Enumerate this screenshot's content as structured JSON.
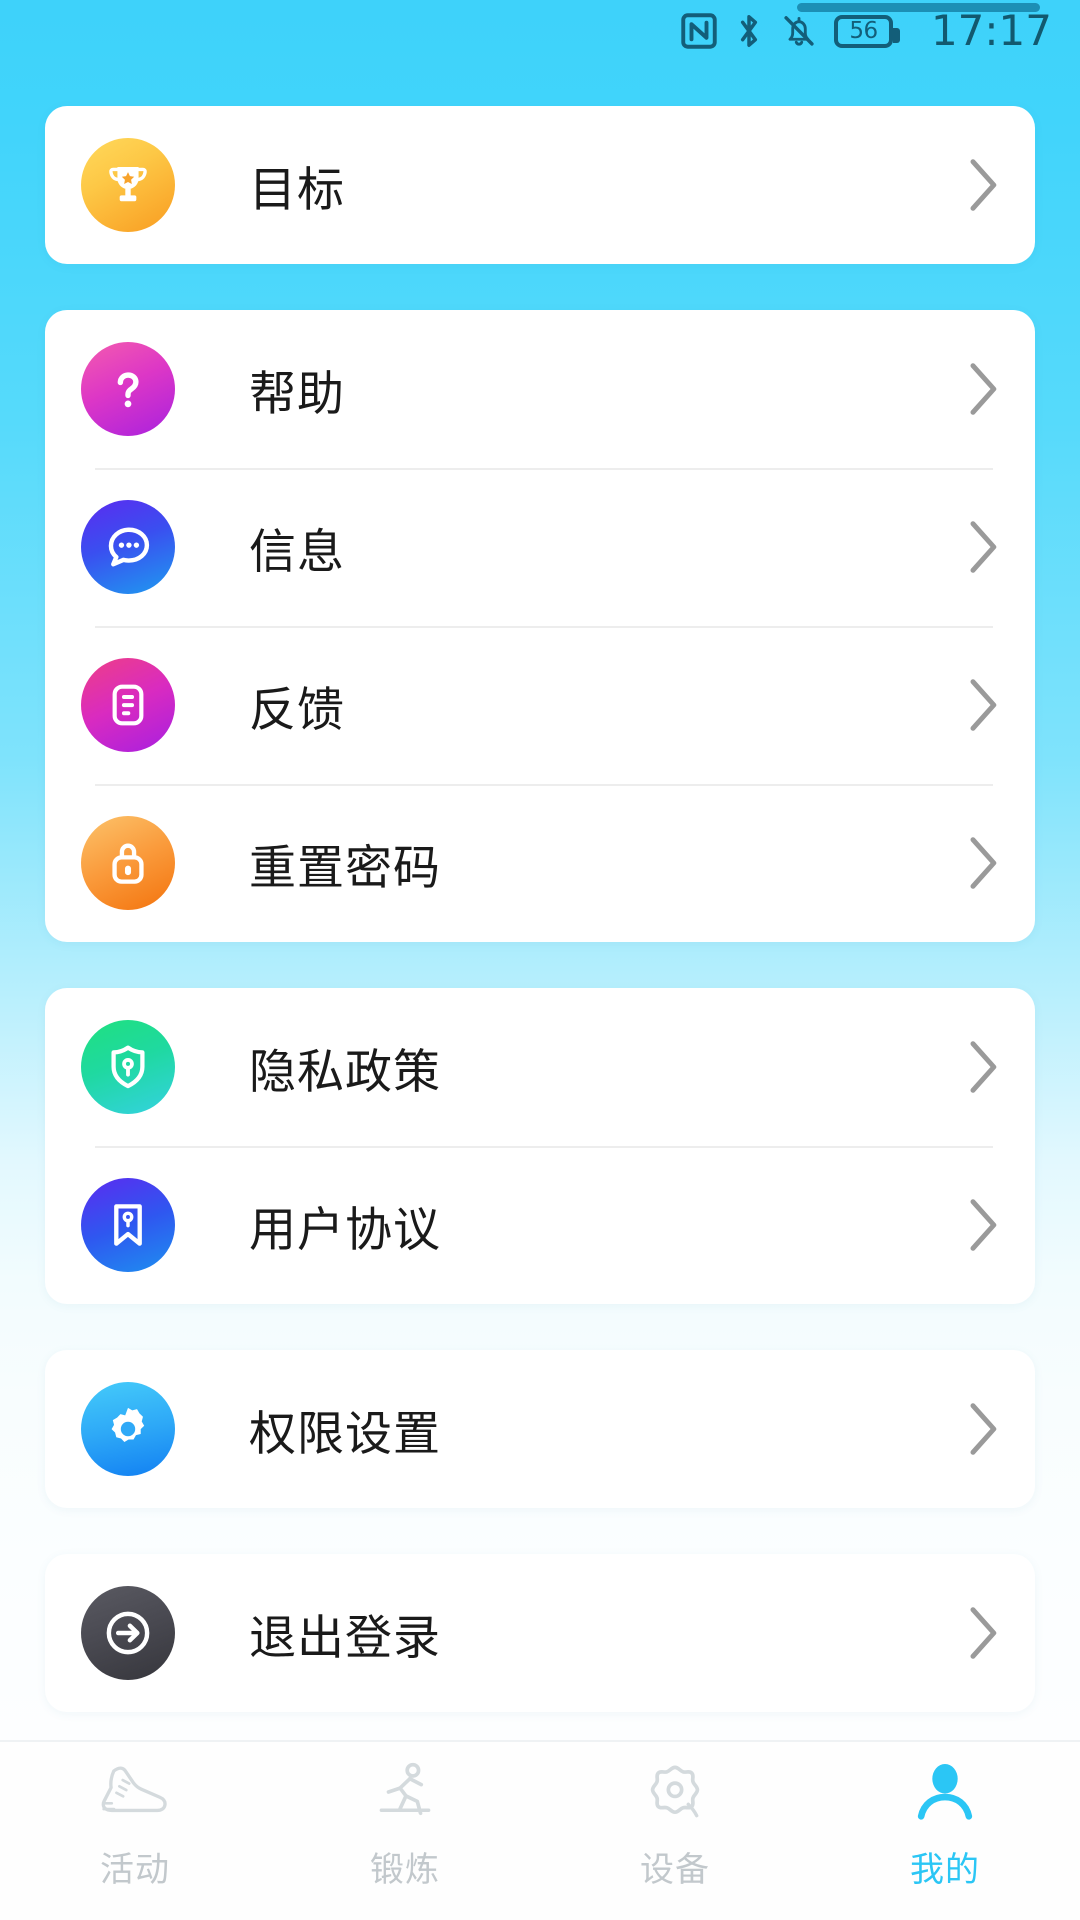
{
  "status_bar": {
    "icons": [
      "nfc-icon",
      "bluetooth-icon",
      "mute-bell-icon"
    ],
    "battery_level": "56",
    "time": "17:17"
  },
  "theme": {
    "background_top": "#3ED2FA",
    "background_bottom": "#FDFEFF",
    "card_background": "#FFFFFF",
    "label_color": "#1A1A1A",
    "chevron_color": "#9A9A9A",
    "accent": "#2BC6F5",
    "nav_inactive": "#C2C8CC"
  },
  "sections": [
    {
      "name": "goals-section",
      "items": [
        {
          "label": "目标",
          "icon": "trophy-icon",
          "icon_style": "g-trophy",
          "name": "goals"
        }
      ]
    },
    {
      "name": "support-section",
      "items": [
        {
          "label": "帮助",
          "icon": "question-mark-icon",
          "icon_style": "g-help",
          "name": "help"
        },
        {
          "label": "信息",
          "icon": "chat-bubble-icon",
          "icon_style": "g-msg",
          "name": "messages"
        },
        {
          "label": "反馈",
          "icon": "document-icon",
          "icon_style": "g-feed",
          "name": "feedback"
        },
        {
          "label": "重置密码",
          "icon": "lock-icon",
          "icon_style": "g-lock",
          "name": "reset-password"
        }
      ]
    },
    {
      "name": "legal-section",
      "items": [
        {
          "label": "隐私政策",
          "icon": "shield-keyhole-icon",
          "icon_style": "g-shield",
          "name": "privacy-policy"
        },
        {
          "label": "用户协议",
          "icon": "bookmark-icon",
          "icon_style": "g-agree",
          "name": "user-agreement"
        }
      ]
    },
    {
      "name": "settings-section",
      "items": [
        {
          "label": "权限设置",
          "icon": "gear-icon",
          "icon_style": "g-perm",
          "name": "permission-settings"
        }
      ]
    },
    {
      "name": "account-section",
      "items": [
        {
          "label": "退出登录",
          "icon": "logout-arrow-icon",
          "icon_style": "g-logout",
          "name": "logout"
        }
      ]
    }
  ],
  "bottom_nav": {
    "items": [
      {
        "label": "活动",
        "icon": "shoe-icon",
        "name": "activity",
        "active": false
      },
      {
        "label": "锻炼",
        "icon": "running-person-icon",
        "name": "exercise",
        "active": false
      },
      {
        "label": "设备",
        "icon": "device-gear-icon",
        "name": "device",
        "active": false
      },
      {
        "label": "我的",
        "icon": "person-icon",
        "name": "mine",
        "active": true
      }
    ]
  }
}
